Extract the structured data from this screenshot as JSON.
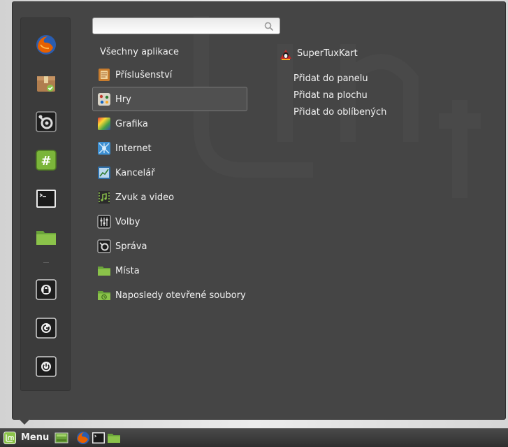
{
  "search": {
    "placeholder": "",
    "value": ""
  },
  "favorites": [
    {
      "name": "firefox",
      "icon": "firefox-icon"
    },
    {
      "name": "software-manager",
      "icon": "package-icon"
    },
    {
      "name": "system-settings",
      "icon": "settings-icon"
    },
    {
      "name": "terminal-green",
      "icon": "hash-terminal-icon"
    },
    {
      "name": "terminal",
      "icon": "terminal-icon"
    },
    {
      "name": "files",
      "icon": "folder-icon"
    },
    {
      "name": "lock-screen",
      "icon": "lock-icon"
    },
    {
      "name": "logout",
      "icon": "logout-icon"
    },
    {
      "name": "shutdown",
      "icon": "power-icon"
    }
  ],
  "menu": {
    "all_apps_label": "Všechny aplikace",
    "categories": [
      {
        "label": "Příslušenství",
        "icon": "accessories-icon",
        "selected": false
      },
      {
        "label": "Hry",
        "icon": "games-icon",
        "selected": true
      },
      {
        "label": "Grafika",
        "icon": "graphics-icon",
        "selected": false
      },
      {
        "label": "Internet",
        "icon": "internet-icon",
        "selected": false
      },
      {
        "label": "Kancelář",
        "icon": "office-icon",
        "selected": false
      },
      {
        "label": "Zvuk a video",
        "icon": "multimedia-icon",
        "selected": false
      },
      {
        "label": "Volby",
        "icon": "preferences-icon",
        "selected": false
      },
      {
        "label": "Správa",
        "icon": "administration-icon",
        "selected": false
      },
      {
        "label": "Místa",
        "icon": "places-folder-icon",
        "selected": false
      },
      {
        "label": "Naposledy otevřené soubory",
        "icon": "recent-files-icon",
        "selected": false
      }
    ]
  },
  "app": {
    "name": "SuperTuxKart",
    "icon": "supertuxkart-icon",
    "actions": [
      "Přidat do panelu",
      "Přidat na plochu",
      "Přidat do oblíbených"
    ]
  },
  "taskbar": {
    "menu_label": "Menu",
    "launchers": [
      "show-desktop-icon",
      "firefox-icon",
      "terminal-icon",
      "folder-icon"
    ]
  },
  "colors": {
    "menu_background": "#454545",
    "sidebar_background": "#3b3b3b",
    "text": "#f2f2f2",
    "accent_green": "#8bc34a"
  }
}
